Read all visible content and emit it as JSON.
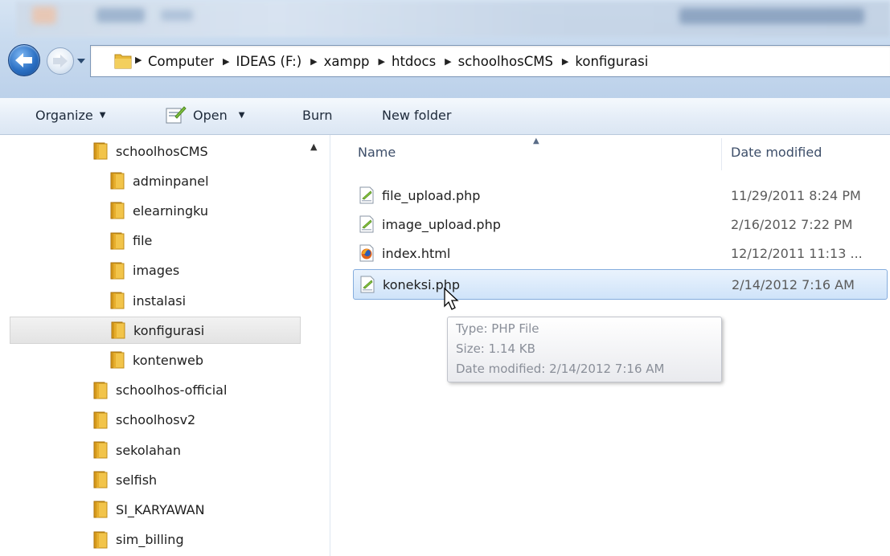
{
  "breadcrumb": {
    "items": [
      "Computer",
      "IDEAS (F:)",
      "xampp",
      "htdocs",
      "schoolhosCMS",
      "konfigurasi"
    ]
  },
  "toolbar": {
    "organize_label": "Organize",
    "open_label": "Open",
    "burn_label": "Burn",
    "new_folder_label": "New folder"
  },
  "sidebar": {
    "items": [
      {
        "label": "schoolhosCMS",
        "level": 0
      },
      {
        "label": "adminpanel",
        "level": 1
      },
      {
        "label": "elearningku",
        "level": 1
      },
      {
        "label": "file",
        "level": 1
      },
      {
        "label": "images",
        "level": 1
      },
      {
        "label": "instalasi",
        "level": 1
      },
      {
        "label": "konfigurasi",
        "level": 1,
        "selected": true
      },
      {
        "label": "kontenweb",
        "level": 1
      },
      {
        "label": "schoolhos-official",
        "level": 0
      },
      {
        "label": "schoolhosv2",
        "level": 0
      },
      {
        "label": "sekolahan",
        "level": 0
      },
      {
        "label": "selfish",
        "level": 0
      },
      {
        "label": "SI_KARYAWAN",
        "level": 0
      },
      {
        "label": "sim_billing",
        "level": 0
      }
    ]
  },
  "file_list": {
    "columns": {
      "name": "Name",
      "date_modified": "Date modified"
    },
    "rows": [
      {
        "name": "file_upload.php",
        "date": "11/29/2011 8:24 PM",
        "icon": "php-file-icon"
      },
      {
        "name": "image_upload.php",
        "date": "2/16/2012 7:22 PM",
        "icon": "php-file-icon"
      },
      {
        "name": "index.html",
        "date": "12/12/2011 11:13 ...",
        "icon": "firefox-html-icon"
      },
      {
        "name": "koneksi.php",
        "date": "2/14/2012 7:16 AM",
        "icon": "php-file-icon",
        "selected": true
      }
    ]
  },
  "tooltip": {
    "type": "Type: PHP File",
    "size": "Size: 1.14 KB",
    "date_modified": "Date modified: 2/14/2012 7:16 AM"
  },
  "colors": {
    "accent": "#84acdd",
    "folder": "#e8b93a",
    "selection": "#cfe3f9"
  }
}
